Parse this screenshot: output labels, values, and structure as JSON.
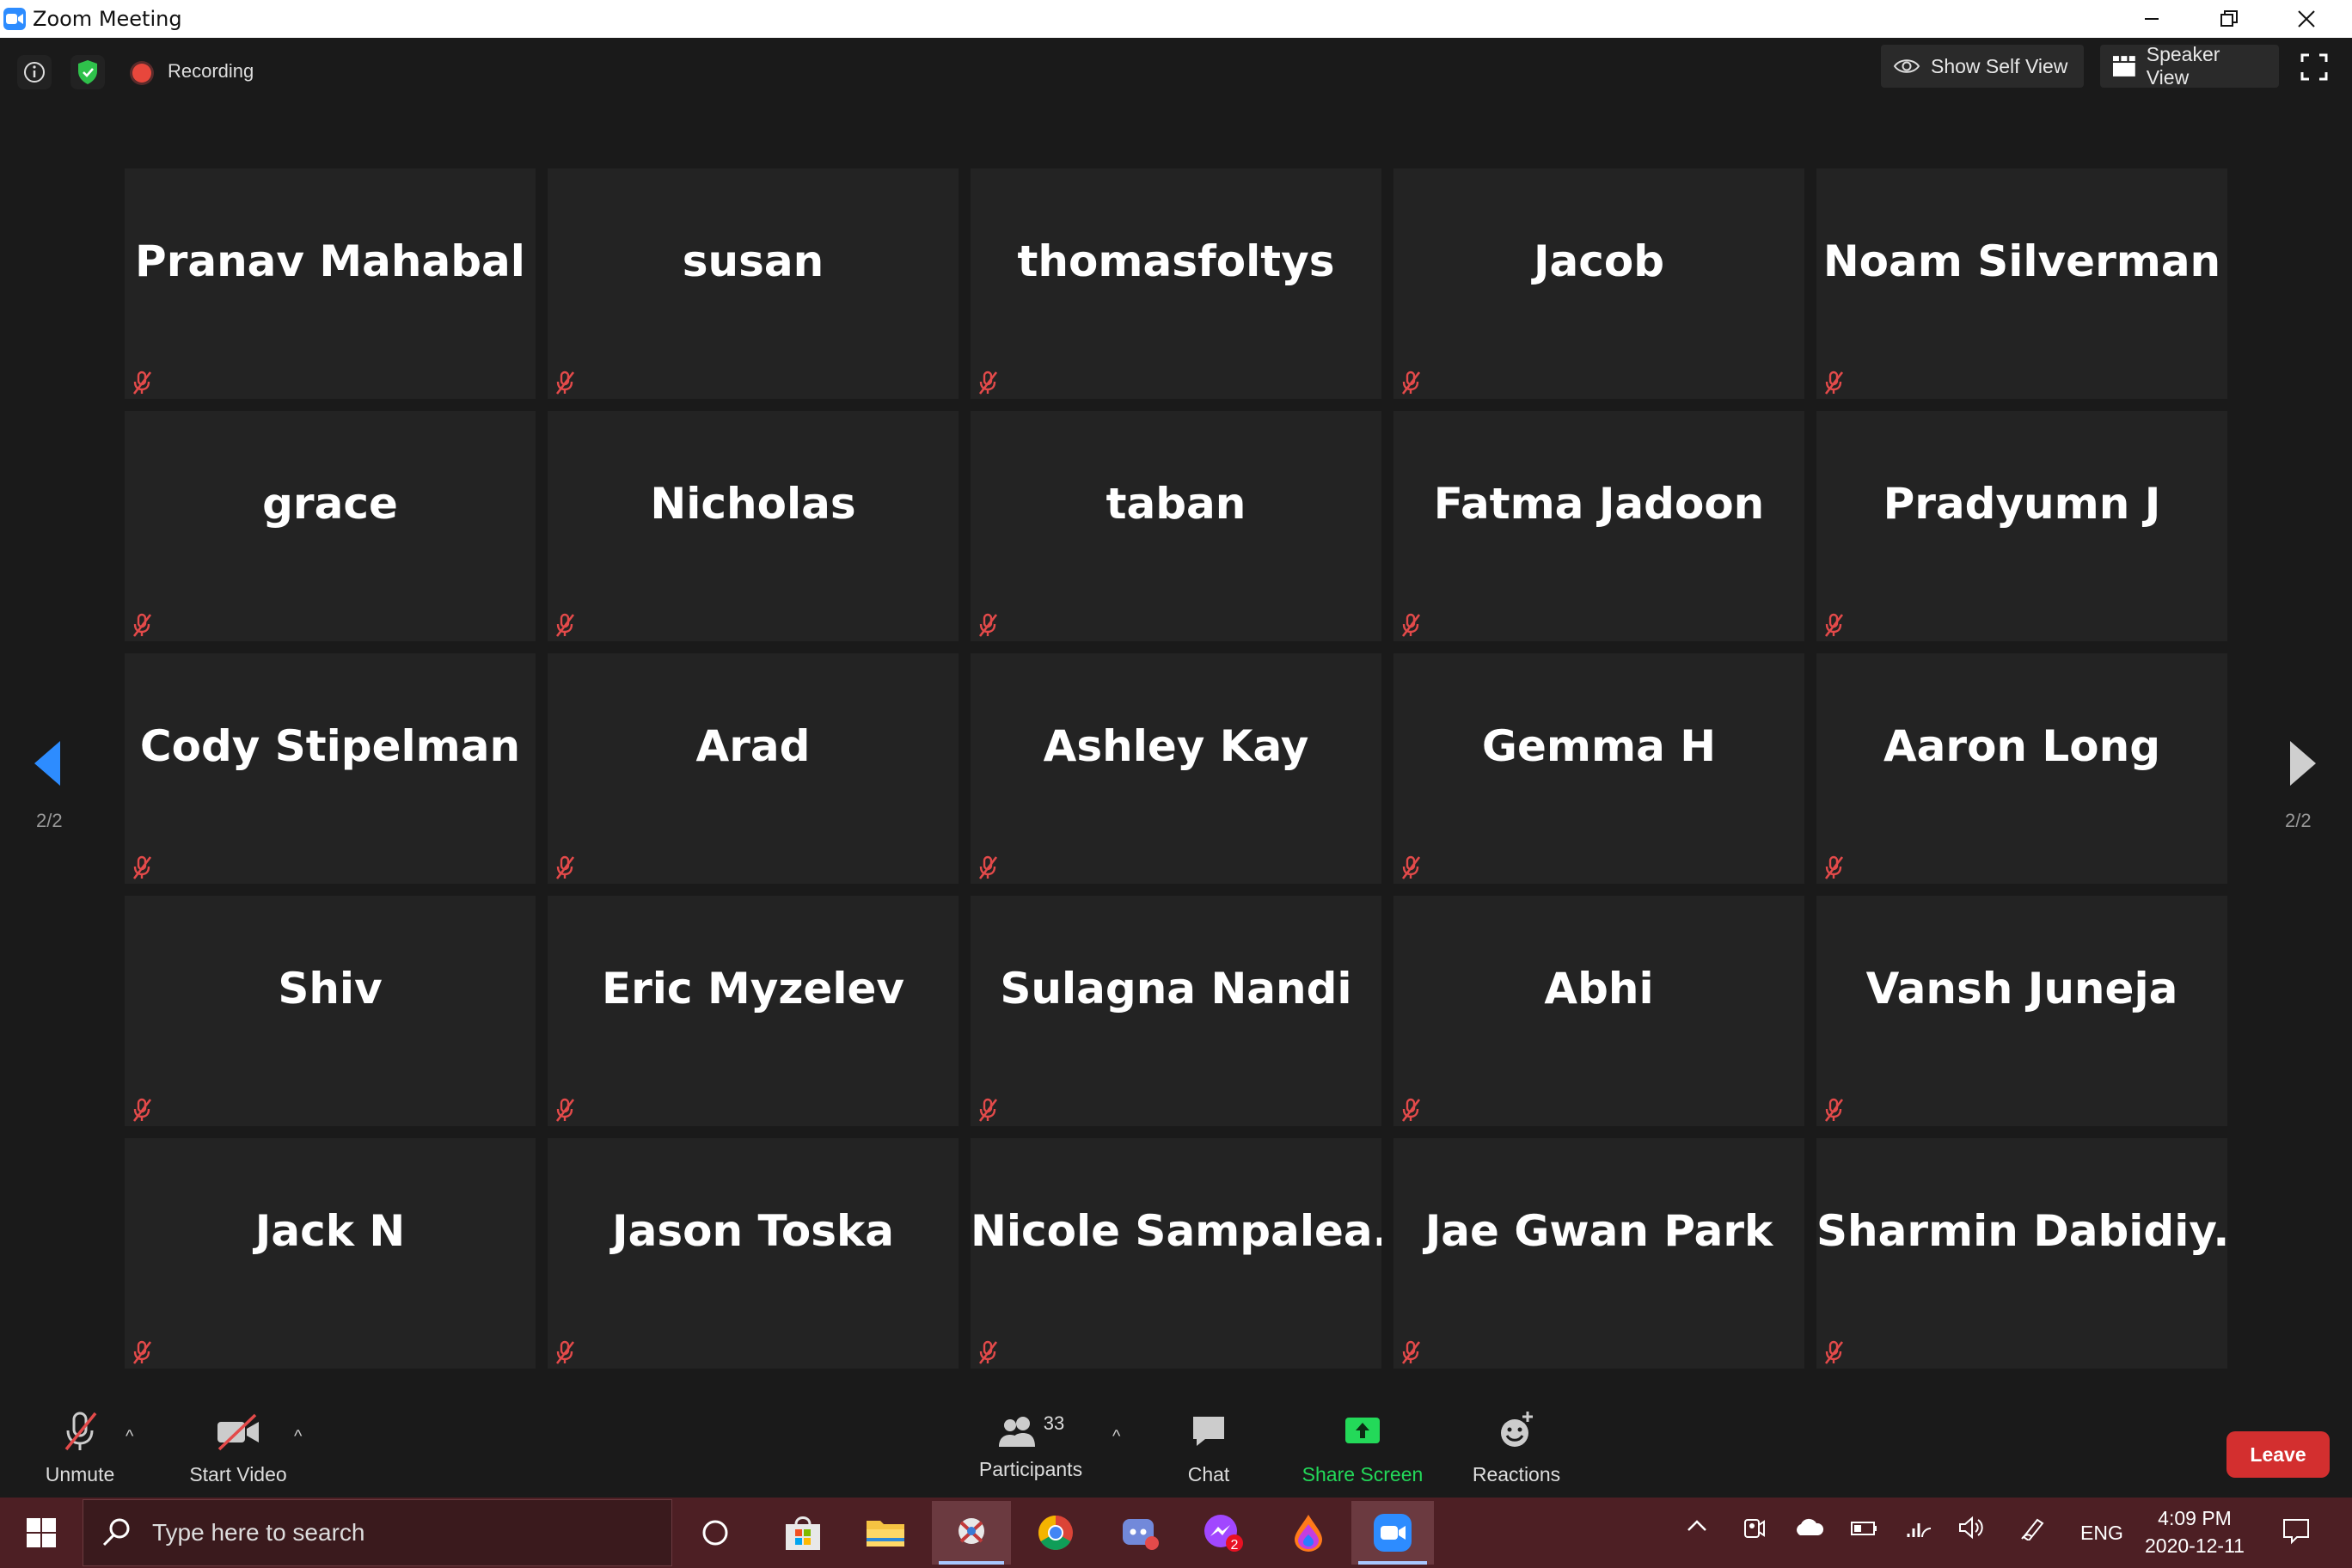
{
  "window": {
    "title": "Zoom Meeting"
  },
  "topbar": {
    "recording_label": "Recording",
    "show_self_view_label": "Show Self View",
    "speaker_view_label": "Speaker View"
  },
  "gallery": {
    "page_indicator_left": "2/2",
    "page_indicator_right": "2/2",
    "participants": [
      "Pranav Mahabal",
      "susan",
      "thomasfoltys",
      "Jacob",
      "Noam Silverman",
      "grace",
      "Nicholas",
      "taban",
      "Fatma Jadoon",
      "Pradyumn J",
      "Cody Stipelman",
      "Arad",
      "Ashley Kay",
      "Gemma H",
      "Aaron Long",
      "Shiv",
      "Eric Myzelev",
      "Sulagna Nandi",
      "Abhi",
      "Vansh Juneja",
      "Jack N",
      "Jason Toska",
      "Nicole  Sampalea...",
      "Jae Gwan Park",
      "Sharmin  Dabidiy..."
    ],
    "all_muted": true
  },
  "toolbar": {
    "unmute_label": "Unmute",
    "start_video_label": "Start Video",
    "participants_label": "Participants",
    "participants_count": "33",
    "chat_label": "Chat",
    "share_screen_label": "Share Screen",
    "reactions_label": "Reactions",
    "leave_label": "Leave"
  },
  "taskbar": {
    "search_placeholder": "Type here to search",
    "messenger_badge": "2",
    "language": "ENG",
    "time": "4:09 PM",
    "date": "2020-12-11"
  },
  "colors": {
    "background": "#1a1a1a",
    "tile": "#232323",
    "mute_icon": "#e34a4a",
    "share_screen": "#23d959",
    "leave": "#d32f2f",
    "zoom_blue": "#2d8cff",
    "pager_arrow": "#2d8cff",
    "taskbar": "#4d1f24"
  }
}
